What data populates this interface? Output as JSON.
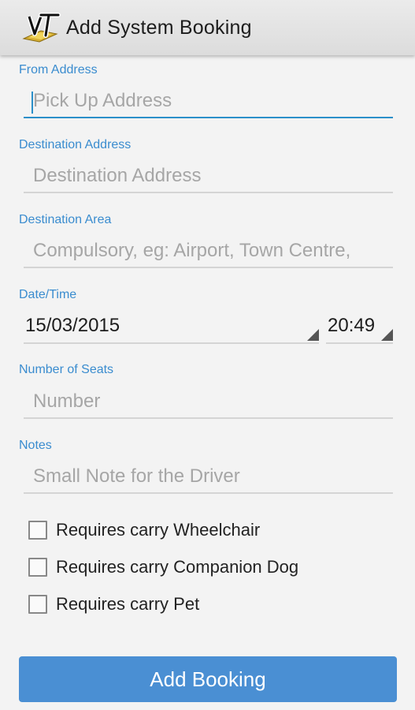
{
  "header": {
    "title": "Add System Booking",
    "logo_icon": "vt-logo-icon"
  },
  "form": {
    "from_address": {
      "label": "From Address",
      "placeholder": "Pick Up Address",
      "value": ""
    },
    "destination_address": {
      "label": "Destination Address",
      "placeholder": "Destination Address",
      "value": ""
    },
    "destination_area": {
      "label": "Destination Area",
      "placeholder": "Compulsory, eg: Airport, Town Centre,",
      "value": ""
    },
    "datetime": {
      "label": "Date/Time",
      "date": "15/03/2015",
      "time": "20:49"
    },
    "seats": {
      "label": "Number of Seats",
      "placeholder": "Number",
      "value": ""
    },
    "notes": {
      "label": "Notes",
      "placeholder": "Small Note for the Driver",
      "value": ""
    },
    "options": [
      {
        "label": "Requires carry Wheelchair",
        "checked": false
      },
      {
        "label": "Requires carry Companion Dog",
        "checked": false
      },
      {
        "label": "Requires carry Pet",
        "checked": false
      }
    ]
  },
  "actions": {
    "submit_label": "Add Booking"
  },
  "colors": {
    "accent": "#3a8ccf",
    "button": "#4a8fd3",
    "focus_underline": "#2b8fc9"
  }
}
